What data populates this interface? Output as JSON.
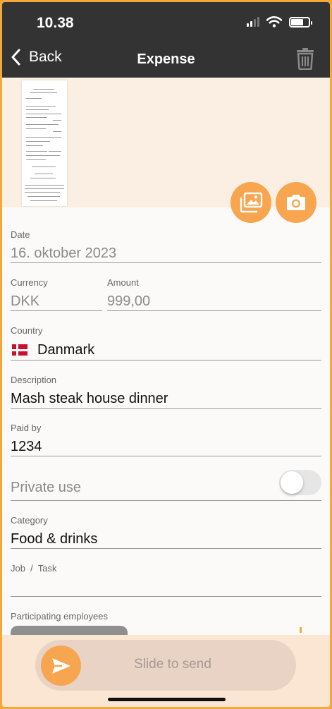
{
  "status": {
    "time": "10.38"
  },
  "nav": {
    "back_label": "Back",
    "title": "Expense"
  },
  "form": {
    "date": {
      "label": "Date",
      "value": "16. oktober 2023"
    },
    "currency": {
      "label": "Currency",
      "value": "DKK"
    },
    "amount": {
      "label": "Amount",
      "value": "999,00"
    },
    "country": {
      "label": "Country",
      "value": "Danmark"
    },
    "description": {
      "label": "Description",
      "value": "Mash steak house dinner"
    },
    "paid_by": {
      "label": "Paid by",
      "value": "1234"
    },
    "private_use": {
      "label": "Private use",
      "value": false
    },
    "category": {
      "label": "Category",
      "value": "Food & drinks"
    },
    "job_task": {
      "label": "Job  /  Task",
      "value": ""
    },
    "participating": {
      "label": "Participating employees"
    }
  },
  "slide": {
    "label": "Slide to send"
  },
  "colors": {
    "header": "#333333",
    "accent": "#f7a64f",
    "receipt_bg": "#fbefe3",
    "bottom_bg": "#fbe6d4"
  },
  "icons": [
    "back-chevron-icon",
    "trash-icon",
    "gallery-icon",
    "camera-icon",
    "send-icon",
    "wifi-icon",
    "battery-icon",
    "signal-icon"
  ]
}
